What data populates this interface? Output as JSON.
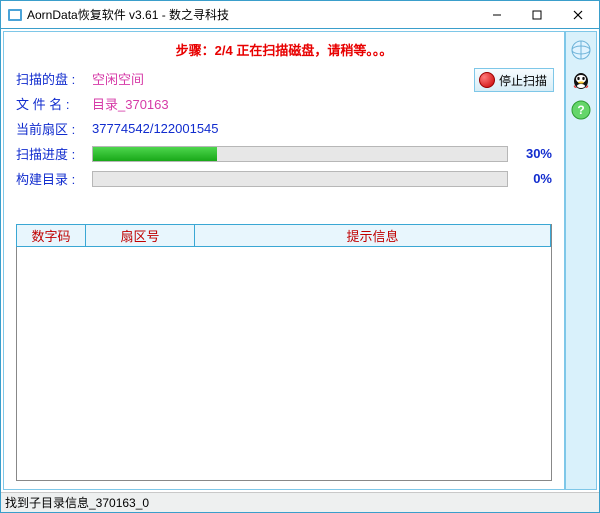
{
  "window": {
    "title": "AornData恢复软件 v3.61   - 数之寻科技"
  },
  "step_text": "步骤：2/4 正在扫描磁盘，请稍等。。。",
  "stop_button_label": "停止扫描",
  "fields": {
    "disk_label": "扫描的盘 :",
    "disk_value": "空闲空间",
    "file_label": "文 件 名  :",
    "file_value": "目录_370163",
    "sector_label": "当前扇区 :",
    "sector_value": "37774542/122001545"
  },
  "progress": {
    "scan_label": "扫描进度 :",
    "scan_percent_text": "30%",
    "scan_percent_value": 30,
    "build_label": "构建目录 :",
    "build_percent_text": "0%",
    "build_percent_value": 0
  },
  "table": {
    "col1": "数字码",
    "col2": "扇区号",
    "col3": "提示信息"
  },
  "statusbar": "找到子目录信息_370163_0"
}
